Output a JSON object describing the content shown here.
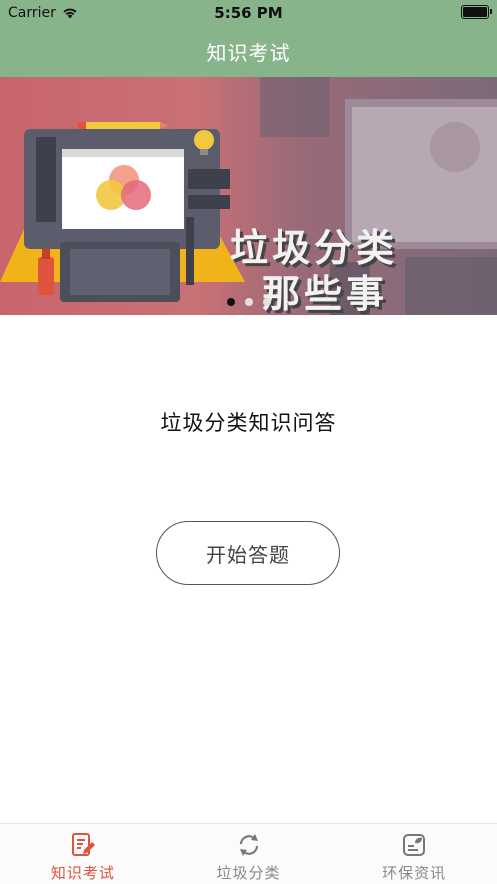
{
  "status_bar": {
    "carrier": "Carrier",
    "time": "5:56 PM"
  },
  "nav": {
    "title": "知识考试"
  },
  "banner": {
    "text_line1": "垃圾分类",
    "text_line2": "那些事",
    "dot_count": 3,
    "active_dot": 0
  },
  "main": {
    "title": "垃圾分类知识问答",
    "start_button": "开始答题"
  },
  "tab_bar": {
    "items": [
      {
        "label": "知识考试",
        "icon": "edit-note-icon",
        "active": true
      },
      {
        "label": "垃圾分类",
        "icon": "recycle-arrows-icon",
        "active": false
      },
      {
        "label": "环保资讯",
        "icon": "news-leaf-icon",
        "active": false
      }
    ]
  },
  "colors": {
    "header": "#88b48b",
    "active_tab": "#e0533d",
    "inactive_tab": "#888888"
  }
}
